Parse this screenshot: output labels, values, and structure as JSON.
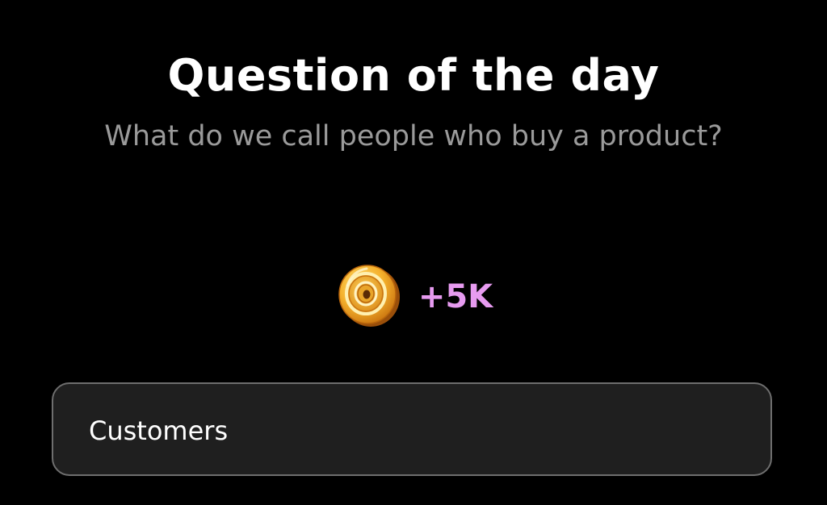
{
  "header": {
    "title": "Question of the day"
  },
  "question": {
    "text": "What do we call people who buy a product?"
  },
  "reward": {
    "icon": "coin-icon",
    "amount": "+5K",
    "amount_color": "#e79bf0"
  },
  "answers": [
    {
      "label": "Customers"
    }
  ],
  "colors": {
    "background": "#000000",
    "option_background": "#1f1f1f",
    "option_border": "#6e6e6e",
    "question_text": "#9a9a9a"
  }
}
